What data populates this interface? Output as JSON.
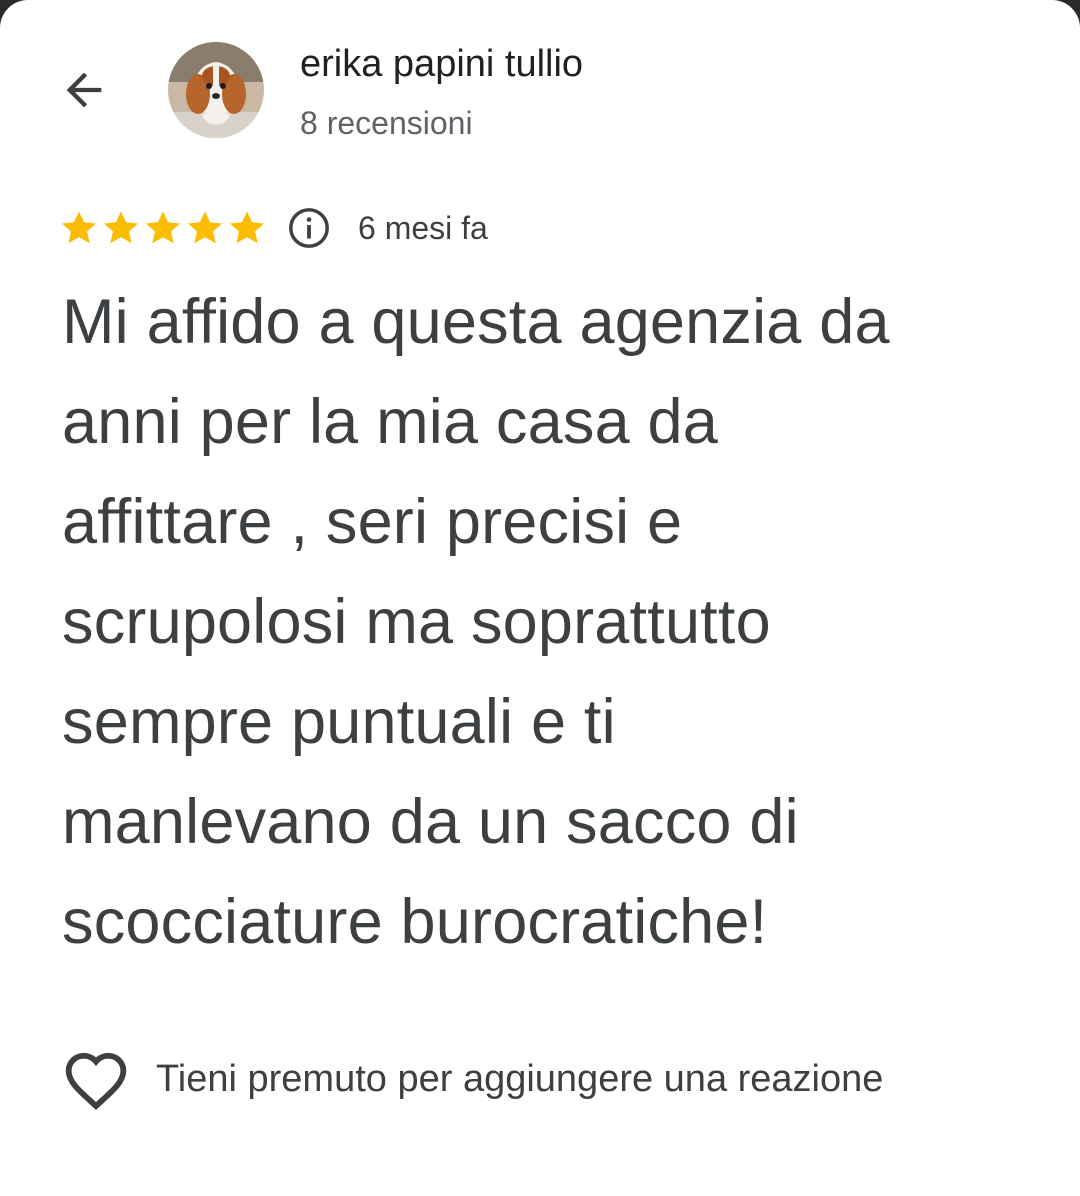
{
  "header": {
    "back_icon": "arrow-back-icon",
    "avatar_icon": "dog-avatar-photo",
    "author_name": "erika papini tullio",
    "review_count": "8 recensioni"
  },
  "review": {
    "rating": 5,
    "rating_max": 5,
    "star_color": "#fbbc04",
    "info_icon": "info-icon",
    "time_ago": "6 mesi fa",
    "text": "Mi affido a questa agenzia da\nanni per la mia casa da\naffittare , seri precisi e\nscrupolosi ma soprattutto\nsempre puntuali e ti\nmanlevano da un sacco di\nscocciature burocratiche!"
  },
  "reaction": {
    "icon": "heart-outline-icon",
    "label": "Tieni premuto per aggiungere una reazione"
  },
  "colors": {
    "text_primary": "#202124",
    "text_body": "#3c4043",
    "text_secondary": "#5f6368"
  }
}
